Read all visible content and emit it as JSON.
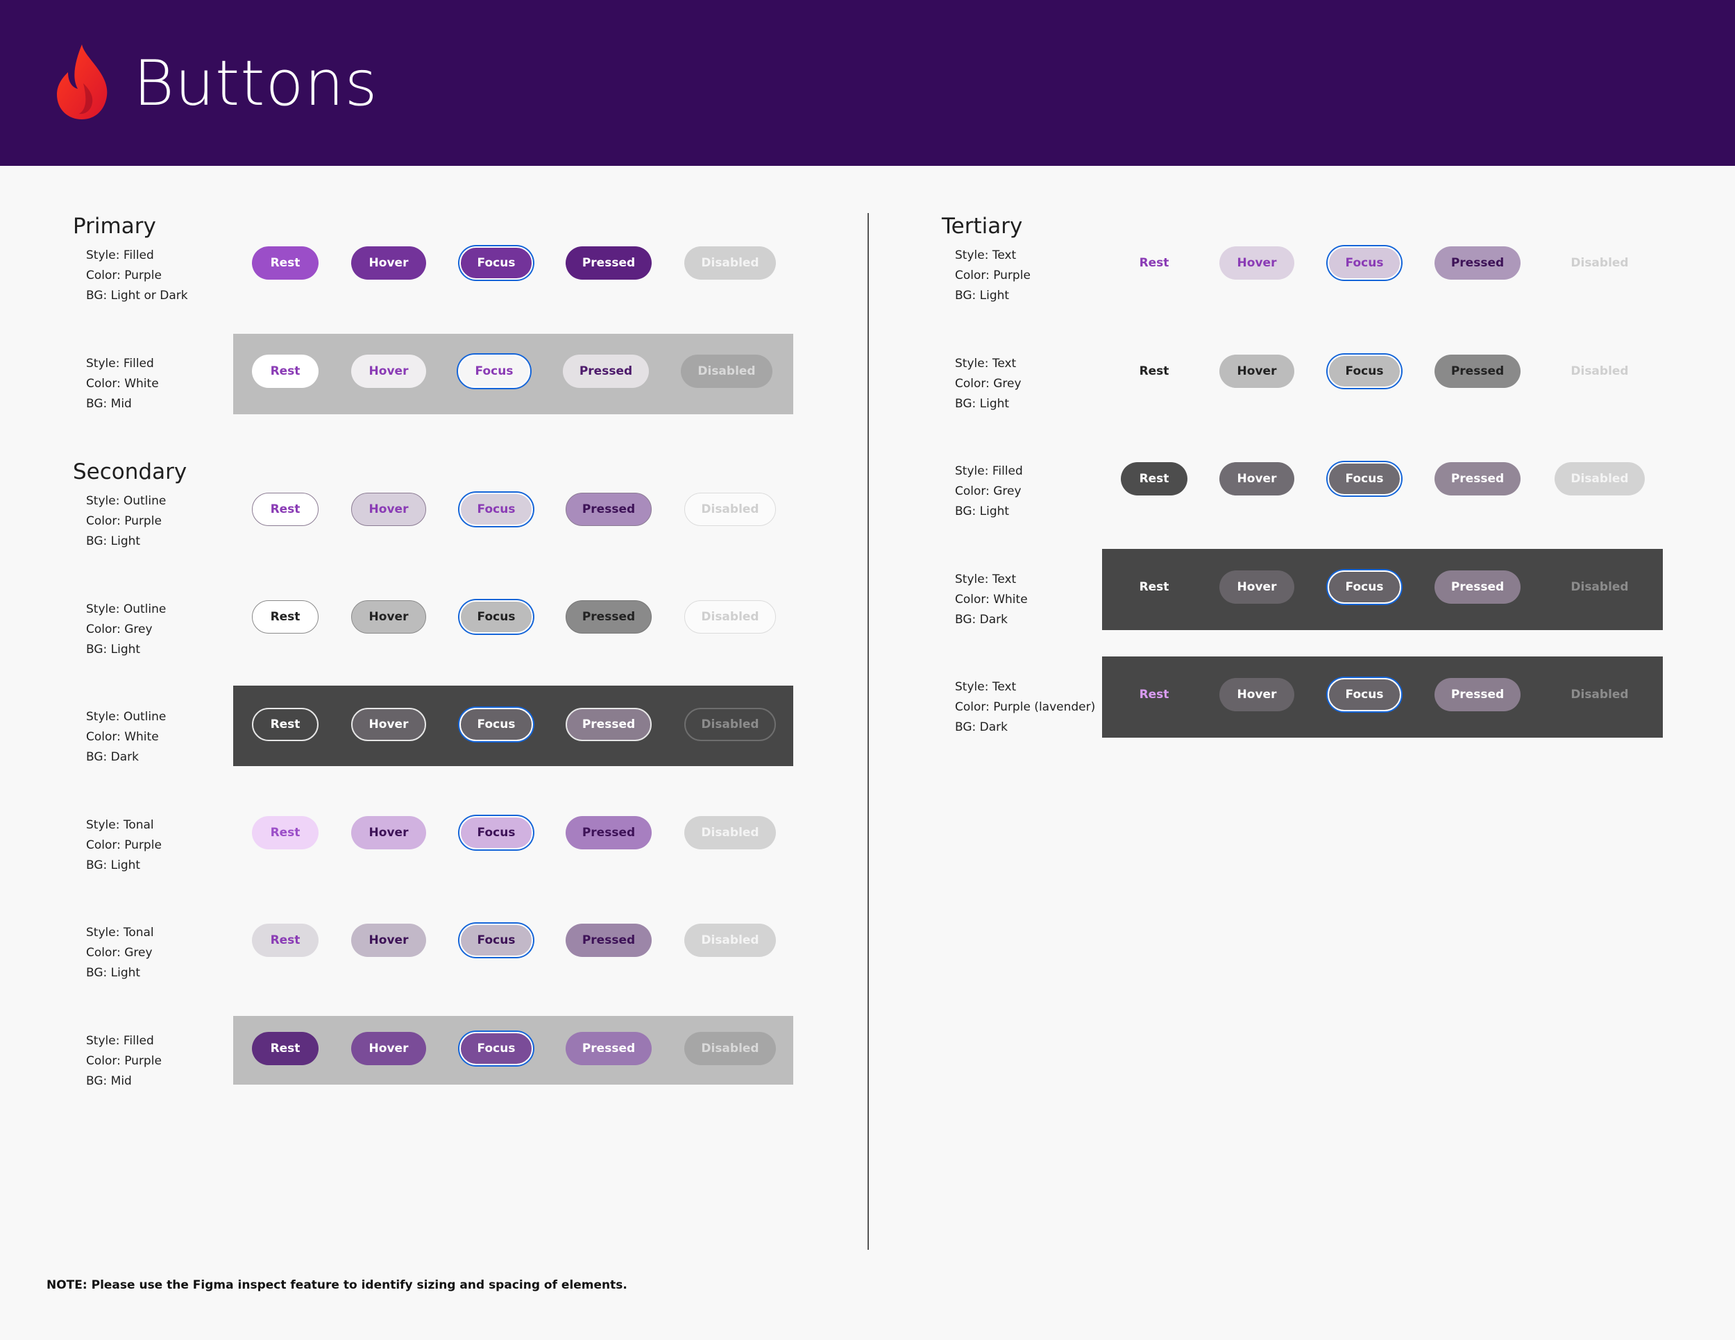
{
  "header": {
    "title": "Buttons",
    "bg": "#350b5a"
  },
  "note": "NOTE: Please use the Figma inspect feature to identify sizing and spacing of elements.",
  "sections": [
    {
      "key": "primary",
      "title": "Primary"
    },
    {
      "key": "secondary",
      "title": "Secondary"
    },
    {
      "key": "tertiary",
      "title": "Tertiary"
    }
  ],
  "rows": [
    {
      "id": "primary-filled-purple",
      "desc": [
        "Style: Filled",
        "Color: Purple",
        "BG: Light or Dark"
      ],
      "buttons": [
        {
          "label": "Rest",
          "bg": "#9b4ec8",
          "color": "#ffffff",
          "border": "none",
          "focus": false
        },
        {
          "label": "Hover",
          "bg": "#73339a",
          "color": "#ffffff",
          "border": "none",
          "focus": false
        },
        {
          "label": "Focus",
          "bg": "#73339a",
          "color": "#ffffff",
          "border": "2px solid #ffffff",
          "focus": true
        },
        {
          "label": "Pressed",
          "bg": "#5c2180",
          "color": "#ffffff",
          "border": "none",
          "focus": false
        },
        {
          "label": "Disabled",
          "bg": "#d0d0d0",
          "color": "#f4f4f4",
          "border": "none",
          "focus": false
        }
      ]
    },
    {
      "id": "primary-filled-white",
      "desc": [
        "Style: Filled",
        "Color: White",
        "BG: Mid"
      ],
      "panel": "#bdbdbd",
      "buttons": [
        {
          "label": "Rest",
          "bg": "#ffffff",
          "color": "#8a3bb5",
          "border": "none",
          "focus": false
        },
        {
          "label": "Hover",
          "bg": "#f0eef0",
          "color": "#8a3bb5",
          "border": "none",
          "focus": false
        },
        {
          "label": "Focus",
          "bg": "#f6f6f6",
          "color": "#8a3bb5",
          "border": "2px solid #ffffff",
          "focus": true
        },
        {
          "label": "Pressed",
          "bg": "#e4e1e4",
          "color": "#4d1a6b",
          "border": "none",
          "focus": false
        },
        {
          "label": "Disabled",
          "bg": "#a6a6a6",
          "color": "#d9d9d9",
          "border": "none",
          "focus": false
        }
      ]
    },
    {
      "id": "secondary-outline-purple",
      "desc": [
        "Style: Outline",
        "Color: Purple",
        "BG: Light"
      ],
      "buttons": [
        {
          "label": "Rest",
          "bg": "#ffffff",
          "color": "#8a3bb5",
          "border": "1.5px solid #8c7c94",
          "focus": false
        },
        {
          "label": "Hover",
          "bg": "#d7cfdc",
          "color": "#8a3bb5",
          "border": "1.5px solid #8c7c94",
          "focus": false
        },
        {
          "label": "Focus",
          "bg": "#d7cfdc",
          "color": "#8a3bb5",
          "border": "2px solid #ffffff",
          "focus": true
        },
        {
          "label": "Pressed",
          "bg": "#a98cbc",
          "color": "#3d1257",
          "border": "1.5px solid #8c7c94",
          "focus": false
        },
        {
          "label": "Disabled",
          "bg": "#fbfbfb",
          "color": "#cfcfcf",
          "border": "1.5px solid #dcdcdc",
          "focus": false
        }
      ]
    },
    {
      "id": "secondary-outline-grey",
      "desc": [
        "Style: Outline",
        "Color: Grey",
        "BG: Light"
      ],
      "buttons": [
        {
          "label": "Rest",
          "bg": "#ffffff",
          "color": "#222222",
          "border": "1.5px solid #8a8a8a",
          "focus": false
        },
        {
          "label": "Hover",
          "bg": "#bcbcbc",
          "color": "#222222",
          "border": "1.5px solid #8a8a8a",
          "focus": false
        },
        {
          "label": "Focus",
          "bg": "#bcbcbc",
          "color": "#222222",
          "border": "2px solid #ffffff",
          "focus": true
        },
        {
          "label": "Pressed",
          "bg": "#8a8a8a",
          "color": "#222222",
          "border": "1.5px solid #777777",
          "focus": false
        },
        {
          "label": "Disabled",
          "bg": "#fbfbfb",
          "color": "#cfcfcf",
          "border": "1.5px solid #dcdcdc",
          "focus": false
        }
      ]
    },
    {
      "id": "secondary-outline-white",
      "desc": [
        "Style: Outline",
        "Color: White",
        "BG: Dark"
      ],
      "panel": "#474747",
      "buttons": [
        {
          "label": "Rest",
          "bg": "#474747",
          "color": "#ffffff",
          "border": "2px solid #e6e6e6",
          "focus": false
        },
        {
          "label": "Hover",
          "bg": "#676368",
          "color": "#ffffff",
          "border": "2px solid #e6e6e6",
          "focus": false
        },
        {
          "label": "Focus",
          "bg": "#676368",
          "color": "#ffffff",
          "border": "2px solid #ffffff",
          "focus": true
        },
        {
          "label": "Pressed",
          "bg": "#8a7d8e",
          "color": "#ffffff",
          "border": "2px solid #e6e6e6",
          "focus": false
        },
        {
          "label": "Disabled",
          "bg": "#474747",
          "color": "#8c8c8c",
          "border": "2px solid #6e6e6e",
          "focus": false
        }
      ]
    },
    {
      "id": "secondary-tonal-purple",
      "desc": [
        "Style: Tonal",
        "Color: Purple",
        "BG: Light"
      ],
      "buttons": [
        {
          "label": "Rest",
          "bg": "#efd4f8",
          "color": "#9b4ec8",
          "border": "none",
          "focus": false
        },
        {
          "label": "Hover",
          "bg": "#d1b2e0",
          "color": "#3d1257",
          "border": "none",
          "focus": false
        },
        {
          "label": "Focus",
          "bg": "#d1b2e0",
          "color": "#3d1257",
          "border": "2px solid #ffffff",
          "focus": true
        },
        {
          "label": "Pressed",
          "bg": "#a77fc0",
          "color": "#3d1257",
          "border": "none",
          "focus": false
        },
        {
          "label": "Disabled",
          "bg": "#d3d3d3",
          "color": "#f4f4f4",
          "border": "none",
          "focus": false
        }
      ]
    },
    {
      "id": "secondary-tonal-grey",
      "desc": [
        "Style: Tonal",
        "Color: Grey",
        "BG: Light"
      ],
      "buttons": [
        {
          "label": "Rest",
          "bg": "#dddadf",
          "color": "#8a3bb5",
          "border": "none",
          "focus": false
        },
        {
          "label": "Hover",
          "bg": "#c2b8c8",
          "color": "#3d1257",
          "border": "none",
          "focus": false
        },
        {
          "label": "Focus",
          "bg": "#c2b8c8",
          "color": "#3d1257",
          "border": "2px solid #ffffff",
          "focus": true
        },
        {
          "label": "Pressed",
          "bg": "#9c86a8",
          "color": "#3d1257",
          "border": "none",
          "focus": false
        },
        {
          "label": "Disabled",
          "bg": "#d3d3d3",
          "color": "#f4f4f4",
          "border": "none",
          "focus": false
        }
      ]
    },
    {
      "id": "secondary-filled-purple-mid",
      "desc": [
        "Style: Filled",
        "Color: Purple",
        "BG: Mid"
      ],
      "panel": "#bdbdbd",
      "buttons": [
        {
          "label": "Rest",
          "bg": "#5e2e7e",
          "color": "#ffffff",
          "border": "none",
          "focus": false
        },
        {
          "label": "Hover",
          "bg": "#7a4c98",
          "color": "#ffffff",
          "border": "none",
          "focus": false
        },
        {
          "label": "Focus",
          "bg": "#7a4c98",
          "color": "#ffffff",
          "border": "2px solid #ffffff",
          "focus": true
        },
        {
          "label": "Pressed",
          "bg": "#9a78b2",
          "color": "#ffffff",
          "border": "none",
          "focus": false
        },
        {
          "label": "Disabled",
          "bg": "#a6a6a6",
          "color": "#d9d9d9",
          "border": "none",
          "focus": false
        }
      ]
    },
    {
      "id": "tertiary-text-purple",
      "desc": [
        "Style: Text",
        "Color: Purple",
        "BG: Light"
      ],
      "buttons": [
        {
          "label": "Rest",
          "bg": "transparent",
          "color": "#8a3bb5",
          "border": "none",
          "focus": false
        },
        {
          "label": "Hover",
          "bg": "#ddd2e2",
          "color": "#8a3bb5",
          "border": "none",
          "focus": false
        },
        {
          "label": "Focus",
          "bg": "#d5c8dc",
          "color": "#8a3bb5",
          "border": "2px solid #ffffff",
          "focus": true
        },
        {
          "label": "Pressed",
          "bg": "#ad98ba",
          "color": "#3d1257",
          "border": "none",
          "focus": false
        },
        {
          "label": "Disabled",
          "bg": "transparent",
          "color": "#cfcfcf",
          "border": "none",
          "focus": false
        }
      ]
    },
    {
      "id": "tertiary-text-grey",
      "desc": [
        "Style: Text",
        "Color: Grey",
        "BG: Light"
      ],
      "buttons": [
        {
          "label": "Rest",
          "bg": "transparent",
          "color": "#222222",
          "border": "none",
          "focus": false
        },
        {
          "label": "Hover",
          "bg": "#bcbcbc",
          "color": "#222222",
          "border": "none",
          "focus": false
        },
        {
          "label": "Focus",
          "bg": "#bcbcbc",
          "color": "#222222",
          "border": "2px solid #ffffff",
          "focus": true
        },
        {
          "label": "Pressed",
          "bg": "#8a8a8a",
          "color": "#222222",
          "border": "none",
          "focus": false
        },
        {
          "label": "Disabled",
          "bg": "transparent",
          "color": "#cfcfcf",
          "border": "none",
          "focus": false
        }
      ]
    },
    {
      "id": "tertiary-filled-grey",
      "desc": [
        "Style: Filled",
        "Color: Grey",
        "BG: Light"
      ],
      "buttons": [
        {
          "label": "Rest",
          "bg": "#4d4d4d",
          "color": "#ffffff",
          "border": "none",
          "focus": false
        },
        {
          "label": "Hover",
          "bg": "#706c72",
          "color": "#ffffff",
          "border": "none",
          "focus": false
        },
        {
          "label": "Focus",
          "bg": "#706c72",
          "color": "#ffffff",
          "border": "2px solid #ffffff",
          "focus": true
        },
        {
          "label": "Pressed",
          "bg": "#938797",
          "color": "#ffffff",
          "border": "none",
          "focus": false
        },
        {
          "label": "Disabled",
          "bg": "#d3d3d3",
          "color": "#f4f4f4",
          "border": "none",
          "focus": false
        }
      ]
    },
    {
      "id": "tertiary-text-white",
      "desc": [
        "Style: Text",
        "Color: White",
        "BG: Dark"
      ],
      "panel": "#474747",
      "buttons": [
        {
          "label": "Rest",
          "bg": "transparent",
          "color": "#ffffff",
          "border": "none",
          "focus": false
        },
        {
          "label": "Hover",
          "bg": "#676368",
          "color": "#ffffff",
          "border": "none",
          "focus": false
        },
        {
          "label": "Focus",
          "bg": "#676368",
          "color": "#ffffff",
          "border": "2px solid #ffffff",
          "focus": true
        },
        {
          "label": "Pressed",
          "bg": "#8a7d8e",
          "color": "#ffffff",
          "border": "none",
          "focus": false
        },
        {
          "label": "Disabled",
          "bg": "transparent",
          "color": "#8c8c8c",
          "border": "none",
          "focus": false
        }
      ]
    },
    {
      "id": "tertiary-text-lavender",
      "desc": [
        "Style: Text",
        "Color: Purple (lavender)",
        "BG: Dark"
      ],
      "panel": "#474747",
      "buttons": [
        {
          "label": "Rest",
          "bg": "transparent",
          "color": "#d99cf2",
          "border": "none",
          "focus": false
        },
        {
          "label": "Hover",
          "bg": "#676368",
          "color": "#ffffff",
          "border": "none",
          "focus": false
        },
        {
          "label": "Focus",
          "bg": "#676368",
          "color": "#ffffff",
          "border": "2px solid #ffffff",
          "focus": true
        },
        {
          "label": "Pressed",
          "bg": "#8a7d8e",
          "color": "#ffffff",
          "border": "none",
          "focus": false
        },
        {
          "label": "Disabled",
          "bg": "transparent",
          "color": "#8c8c8c",
          "border": "none",
          "focus": false
        }
      ]
    }
  ]
}
